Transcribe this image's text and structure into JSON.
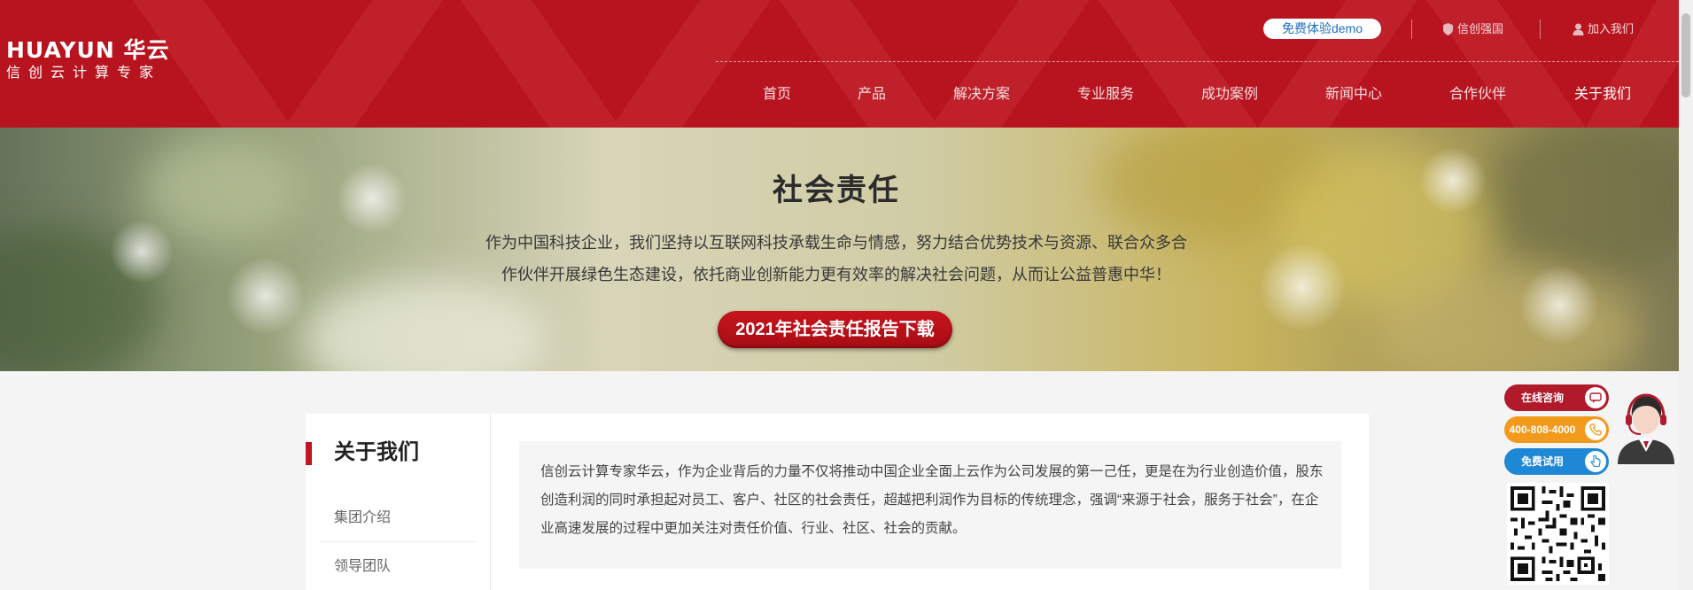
{
  "brand": {
    "logo_text": "HUAYUN 华云",
    "tagline": "信创云计算专家"
  },
  "topbar": {
    "demo_label": "免费体验demo",
    "links": [
      {
        "label": "信创强国",
        "icon": "shield-icon"
      },
      {
        "label": "加入我们",
        "icon": "person-icon"
      }
    ]
  },
  "nav": {
    "items": [
      "首页",
      "产品",
      "解决方案",
      "专业服务",
      "成功案例",
      "新闻中心",
      "合作伙伴",
      "关于我们"
    ],
    "active": "关于我们"
  },
  "banner": {
    "title": "社会责任",
    "text_line1": "作为中国科技企业，我们坚持以互联网科技承载生命与情感，努力结合优势技术与资源、联合众多合",
    "text_line2": "作伙伴开展绿色生态建设，依托商业创新能力更有效率的解决社会问题，从而让公益普惠中华！",
    "button": "2021年社会责任报告下载"
  },
  "sidebar": {
    "title": "关于我们",
    "items": [
      "集团介绍",
      "领导团队"
    ]
  },
  "intro": {
    "text": "信创云计算专家华云，作为企业背后的力量不仅将推动中国企业全面上云作为公司发展的第一己任，更是在为行业创造价值，股东创造利润的同时承担起对员工、客户、社区的社会责任，超越把利润作为目标的传统理念，强调“来源于社会，服务于社会”，在企业高速发展的过程中更加关注对责任价值、行业、社区、社会的贡献。"
  },
  "float": {
    "consult": "在线咨询",
    "phone": "400-808-4000",
    "trial": "免费试用"
  },
  "colors": {
    "brand_red": "#b8141f",
    "float_red": "#b01a2a",
    "float_orange": "#f29a1c",
    "float_blue": "#1e87d6"
  }
}
